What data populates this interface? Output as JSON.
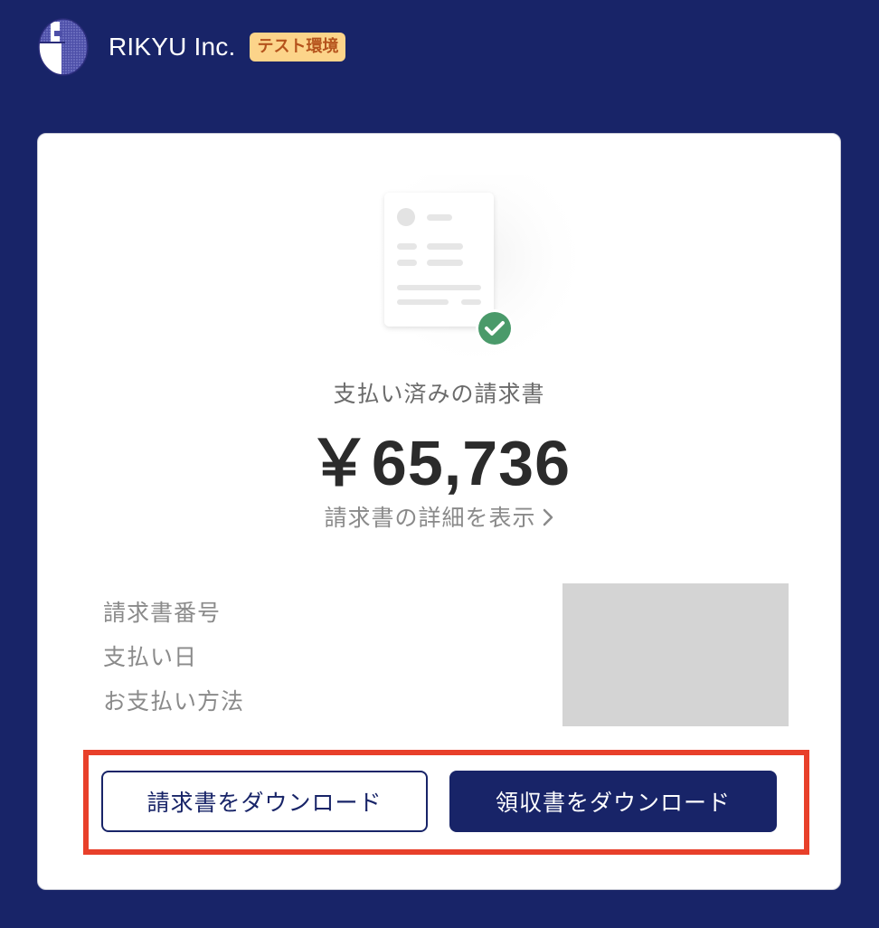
{
  "header": {
    "logo_icon": "company-logo-icon",
    "company_name": "RIKYU Inc.",
    "env_badge": "テスト環境"
  },
  "invoice": {
    "status_label": "支払い済みの請求書",
    "amount": "￥65,736",
    "detail_link": "請求書の詳細を表示",
    "detail_link_icon": "chevron-right-icon",
    "status_icon": "check-circle-icon",
    "fields": [
      "請求書番号",
      "支払い日",
      "お支払い方法"
    ]
  },
  "actions": {
    "download_invoice": "請求書をダウンロード",
    "download_receipt": "領収書をダウンロード"
  },
  "colors": {
    "background": "#182468",
    "badge_bg": "#fcd48a",
    "badge_text": "#b5531c",
    "success": "#4a9a6a",
    "highlight": "#e8402a"
  }
}
